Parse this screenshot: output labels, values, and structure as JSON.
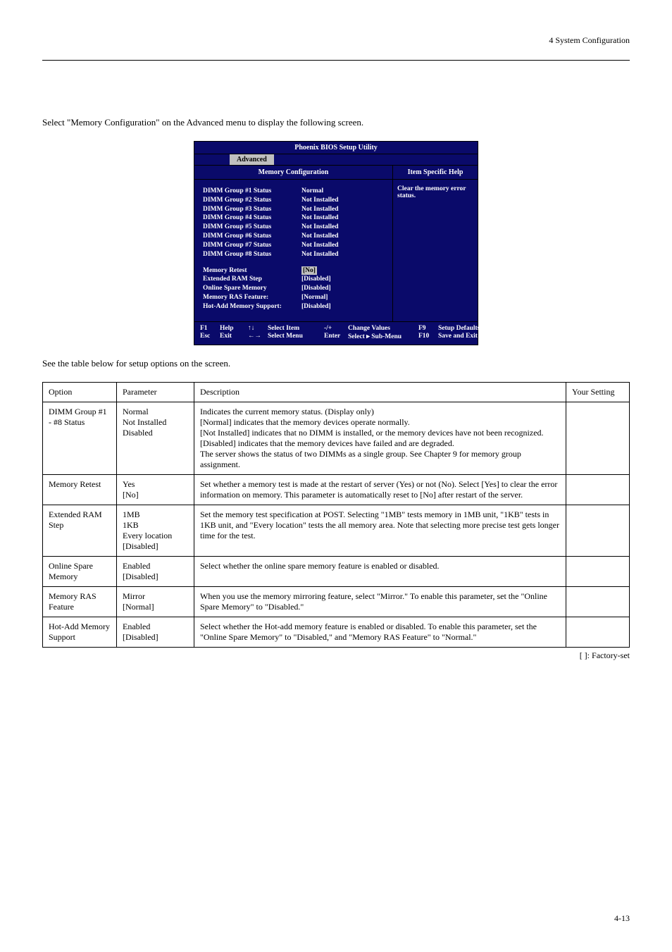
{
  "page": {
    "header_right": "4 System Configuration",
    "intro": "Select \"Memory Configuration\" on the Advanced menu to display the following screen.",
    "page_num": "4-13"
  },
  "bios": {
    "title": "Phoenix BIOS Setup Utility",
    "tab": "Advanced",
    "subtitle": "Memory Configuration",
    "help_title": "Item Specific Help",
    "help_text": "Clear the memory error status.",
    "dimm": [
      {
        "label": "DIMM Group #1 Status",
        "val": "Normal"
      },
      {
        "label": "DIMM Group #2 Status",
        "val": "Not Installed"
      },
      {
        "label": "DIMM Group #3 Status",
        "val": "Not Installed"
      },
      {
        "label": "DIMM Group #4 Status",
        "val": "Not Installed"
      },
      {
        "label": "DIMM Group #5 Status",
        "val": "Not Installed"
      },
      {
        "label": "DIMM Group #6 Status",
        "val": "Not Installed"
      },
      {
        "label": "DIMM Group #7 Status",
        "val": "Not Installed"
      },
      {
        "label": "DIMM Group #8 Status",
        "val": "Not Installed"
      }
    ],
    "opts": [
      {
        "label": "Memory Retest",
        "val": "[No]",
        "hl": true
      },
      {
        "label": "Extended RAM Step",
        "val": "[Disabled]"
      },
      {
        "label": "Online Spare Memory",
        "val": "[Disabled]"
      },
      {
        "label": "Memory RAS Feature:",
        "val": "[Normal]"
      },
      {
        "label": "Hot-Add Memory Support:",
        "val": "[Disabled]"
      }
    ],
    "footer": {
      "f1k": "F1",
      "f1": "Help",
      "arrowsk": "↑↓",
      "arrows": "Select Item",
      "pmk": "-/+",
      "pm": "Change Values",
      "f9k": "F9",
      "f9": "Setup Defaults",
      "esck": "Esc",
      "esc": "Exit",
      "lrk": "←→",
      "lr": "Select Menu",
      "entk": "Enter",
      "ent": "Select ▸ Sub-Menu",
      "f10k": "F10",
      "f10": "Save and Exit"
    }
  },
  "table": {
    "caption": "See the table below for setup options on the screen.",
    "headers": [
      "Option",
      "Parameter",
      "Description",
      "Your Setting"
    ],
    "rows": [
      {
        "option": "DIMM Group #1 - #8 Status",
        "param": "Normal\nNot Installed\nDisabled",
        "desc": "Indicates the current memory status. (Display only)\n[Normal] indicates that the memory devices operate normally.\n[Not Installed] indicates that no DIMM is installed, or the memory devices have not been recognized.\n[Disabled] indicates that the memory devices have failed and are degraded.\nThe server shows the status of two DIMMs as a single group. See Chapter 9 for memory group assignment."
      },
      {
        "option": "Memory Retest",
        "param": "Yes\n[No]",
        "desc": "Set whether a memory test is made at the restart of server (Yes) or not (No). Select [Yes] to clear the error information on memory. This parameter is automatically reset to [No] after restart of the server."
      },
      {
        "option": "Extended RAM Step",
        "param": "1MB\n1KB\nEvery location\n[Disabled]",
        "desc": "Set the memory test specification at POST. Selecting \"1MB\" tests memory in 1MB unit, \"1KB\" tests in 1KB unit, and \"Every location\" tests the all memory area. Note that selecting more precise test gets longer time for the test."
      },
      {
        "option": "Online Spare Memory",
        "param": "Enabled\n[Disabled]",
        "desc": "Select whether the online spare memory feature is enabled or disabled."
      },
      {
        "option": "Memory RAS Feature",
        "param": "Mirror\n[Normal]",
        "desc": "When you use the memory mirroring feature, select \"Mirror.\" To enable this parameter, set the \"Online Spare Memory\" to \"Disabled.\""
      },
      {
        "option": "Hot-Add Memory Support",
        "param": "Enabled\n[Disabled]",
        "desc": "Select whether the Hot-add memory feature is enabled or disabled. To enable this parameter, set the \"Online Spare Memory\" to \"Disabled,\" and \"Memory RAS Feature\" to \"Normal.\""
      }
    ],
    "footnote": "[  ]: Factory-set"
  }
}
